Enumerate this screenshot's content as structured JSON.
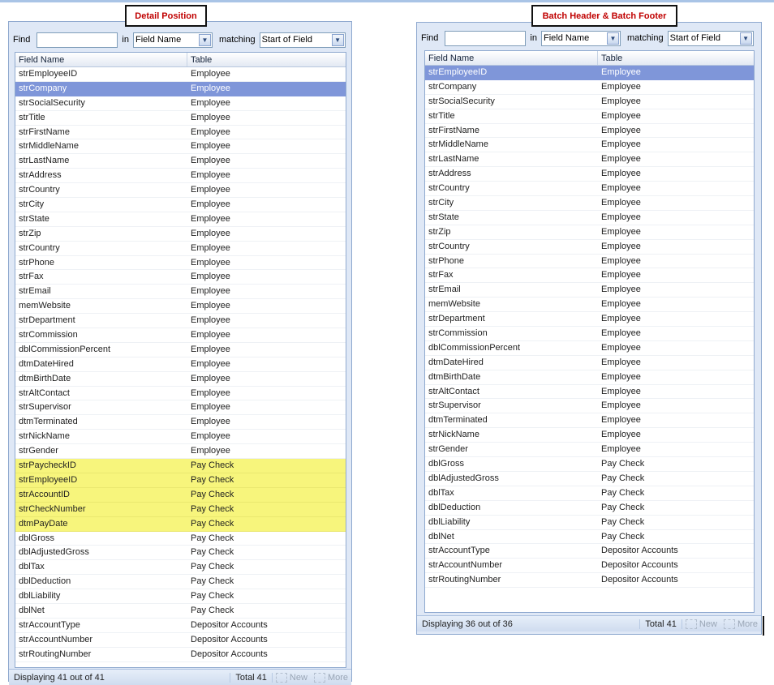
{
  "captions": {
    "left": "Detail Position",
    "right": "Batch Header & Batch Footer"
  },
  "find_bar": {
    "find_label": "Find",
    "in_label": "in",
    "in_value": "Field Name",
    "matching_label": "matching",
    "matching_value": "Start of Field",
    "find_value": ""
  },
  "columns": {
    "field": "Field Name",
    "table": "Table"
  },
  "left_panel": {
    "rows": [
      [
        "strEmployeeID",
        "Employee"
      ],
      [
        "strCompany",
        "Employee"
      ],
      [
        "strSocialSecurity",
        "Employee"
      ],
      [
        "strTitle",
        "Employee"
      ],
      [
        "strFirstName",
        "Employee"
      ],
      [
        "strMiddleName",
        "Employee"
      ],
      [
        "strLastName",
        "Employee"
      ],
      [
        "strAddress",
        "Employee"
      ],
      [
        "strCountry",
        "Employee"
      ],
      [
        "strCity",
        "Employee"
      ],
      [
        "strState",
        "Employee"
      ],
      [
        "strZip",
        "Employee"
      ],
      [
        "strCountry",
        "Employee"
      ],
      [
        "strPhone",
        "Employee"
      ],
      [
        "strFax",
        "Employee"
      ],
      [
        "strEmail",
        "Employee"
      ],
      [
        "memWebsite",
        "Employee"
      ],
      [
        "strDepartment",
        "Employee"
      ],
      [
        "strCommission",
        "Employee"
      ],
      [
        "dblCommissionPercent",
        "Employee"
      ],
      [
        "dtmDateHired",
        "Employee"
      ],
      [
        "dtmBirthDate",
        "Employee"
      ],
      [
        "strAltContact",
        "Employee"
      ],
      [
        "strSupervisor",
        "Employee"
      ],
      [
        "dtmTerminated",
        "Employee"
      ],
      [
        "strNickName",
        "Employee"
      ],
      [
        "strGender",
        "Employee"
      ],
      [
        "strPaycheckID",
        "Pay Check"
      ],
      [
        "strEmployeeID",
        "Pay Check"
      ],
      [
        "strAccountID",
        "Pay Check"
      ],
      [
        "strCheckNumber",
        "Pay Check"
      ],
      [
        "dtmPayDate",
        "Pay Check"
      ],
      [
        "dblGross",
        "Pay Check"
      ],
      [
        "dblAdjustedGross",
        "Pay Check"
      ],
      [
        "dblTax",
        "Pay Check"
      ],
      [
        "dblDeduction",
        "Pay Check"
      ],
      [
        "dblLiability",
        "Pay Check"
      ],
      [
        "dblNet",
        "Pay Check"
      ],
      [
        "strAccountType",
        "Depositor Accounts"
      ],
      [
        "strAccountNumber",
        "Depositor Accounts"
      ],
      [
        "strRoutingNumber",
        "Depositor Accounts"
      ]
    ],
    "selected_index": 1,
    "highlighted_indices": [
      27,
      28,
      29,
      30,
      31
    ],
    "status": {
      "displaying": "Displaying 41 out of 41",
      "total": "Total 41",
      "new": "New",
      "more": "More"
    }
  },
  "right_panel": {
    "rows": [
      [
        "strEmployeeID",
        "Employee"
      ],
      [
        "strCompany",
        "Employee"
      ],
      [
        "strSocialSecurity",
        "Employee"
      ],
      [
        "strTitle",
        "Employee"
      ],
      [
        "strFirstName",
        "Employee"
      ],
      [
        "strMiddleName",
        "Employee"
      ],
      [
        "strLastName",
        "Employee"
      ],
      [
        "strAddress",
        "Employee"
      ],
      [
        "strCountry",
        "Employee"
      ],
      [
        "strCity",
        "Employee"
      ],
      [
        "strState",
        "Employee"
      ],
      [
        "strZip",
        "Employee"
      ],
      [
        "strCountry",
        "Employee"
      ],
      [
        "strPhone",
        "Employee"
      ],
      [
        "strFax",
        "Employee"
      ],
      [
        "strEmail",
        "Employee"
      ],
      [
        "memWebsite",
        "Employee"
      ],
      [
        "strDepartment",
        "Employee"
      ],
      [
        "strCommission",
        "Employee"
      ],
      [
        "dblCommissionPercent",
        "Employee"
      ],
      [
        "dtmDateHired",
        "Employee"
      ],
      [
        "dtmBirthDate",
        "Employee"
      ],
      [
        "strAltContact",
        "Employee"
      ],
      [
        "strSupervisor",
        "Employee"
      ],
      [
        "dtmTerminated",
        "Employee"
      ],
      [
        "strNickName",
        "Employee"
      ],
      [
        "strGender",
        "Employee"
      ],
      [
        "dblGross",
        "Pay Check"
      ],
      [
        "dblAdjustedGross",
        "Pay Check"
      ],
      [
        "dblTax",
        "Pay Check"
      ],
      [
        "dblDeduction",
        "Pay Check"
      ],
      [
        "dblLiability",
        "Pay Check"
      ],
      [
        "dblNet",
        "Pay Check"
      ],
      [
        "strAccountType",
        "Depositor Accounts"
      ],
      [
        "strAccountNumber",
        "Depositor Accounts"
      ],
      [
        "strRoutingNumber",
        "Depositor Accounts"
      ]
    ],
    "selected_index": 0,
    "highlighted_indices": [],
    "status": {
      "displaying": "Displaying 36 out of 36",
      "total": "Total 41",
      "new": "New",
      "more": "More"
    }
  },
  "colors": {
    "selection": "#7f96d9",
    "highlight": "#f7f57c",
    "caption_text": "#c00000",
    "panel_bg": "#dfe8f6"
  }
}
